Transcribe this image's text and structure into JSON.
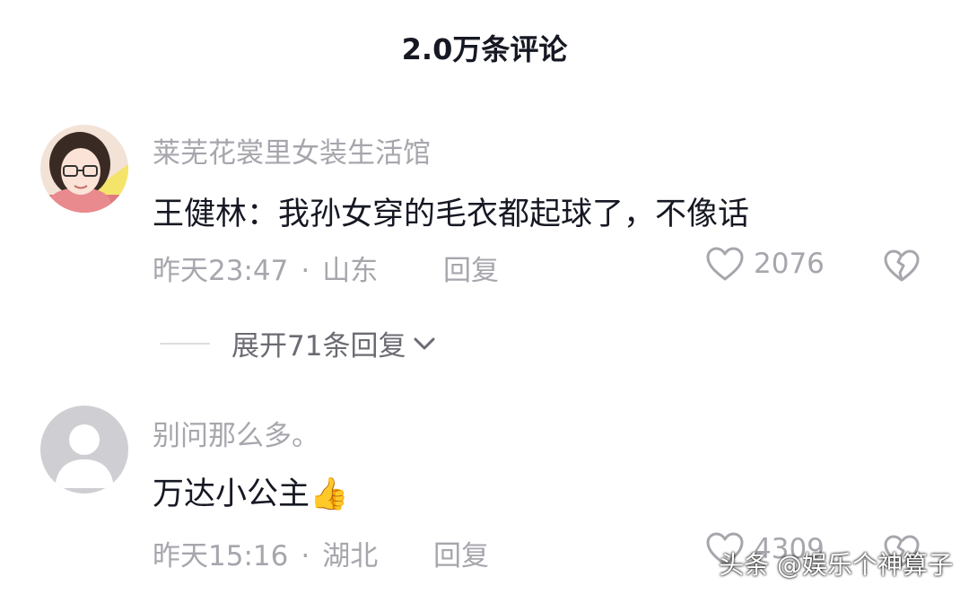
{
  "header": {
    "title": "2.0万条评论"
  },
  "comments": [
    {
      "username": "莱芜花裳里女装生活馆",
      "text": "王健林：我孙女穿的毛衣都起球了，不像话",
      "time": "昨天23:47",
      "separator": "·",
      "location": "山东",
      "reply_label": "回复",
      "likes": "2076",
      "expand_label": "展开71条回复"
    },
    {
      "username": "别问那么多。",
      "text": "万达小公主",
      "emoji": "👍",
      "time": "昨天15:16",
      "separator": "·",
      "location": "湖北",
      "reply_label": "回复",
      "likes": "4309"
    }
  ],
  "watermark": "头条 @娱乐个神算子",
  "colors": {
    "primary_text": "#161823",
    "secondary_text": "#a6a6ad",
    "icon": "#a6a6ad"
  }
}
